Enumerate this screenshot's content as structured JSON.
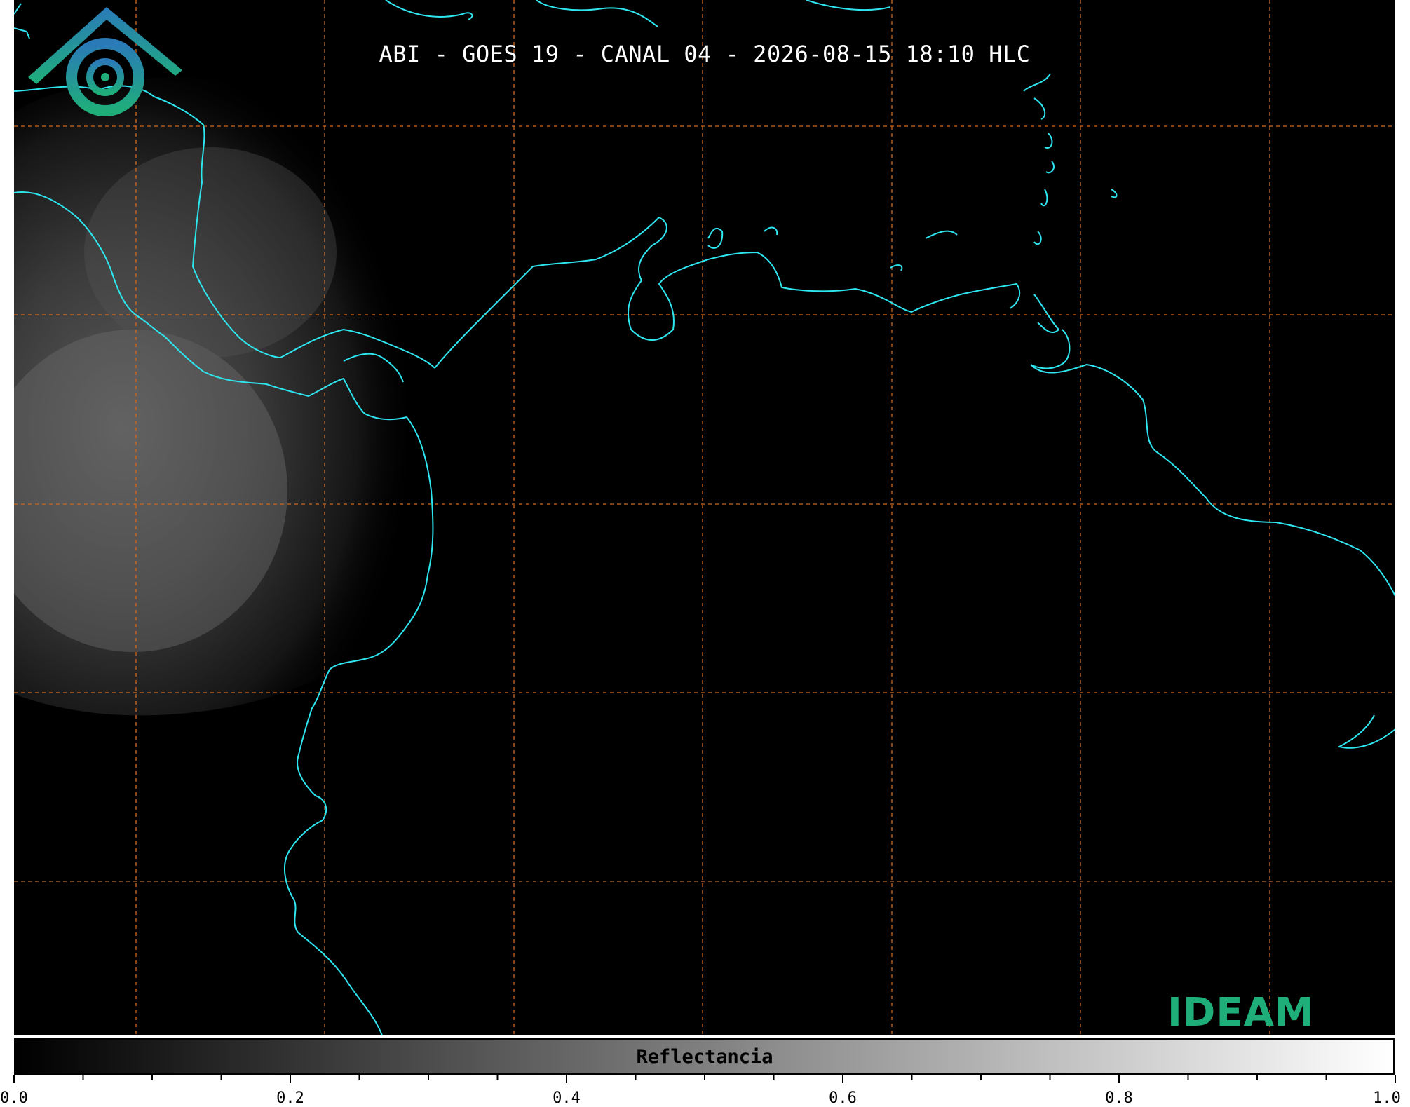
{
  "title": "ABI - GOES 19 - CANAL 04 - 2026-08-15 18:10 HLC",
  "logo": {
    "text": "IDEAM",
    "icon": "ideam-logo-icon"
  },
  "colorbar": {
    "label": "Reflectancia",
    "range": [
      0.0,
      1.0
    ],
    "tick_labels": [
      "0.0",
      "0.2",
      "0.4",
      "0.6",
      "0.8",
      "1.0"
    ],
    "colors": {
      "low": "#000000",
      "high": "#ffffff"
    }
  },
  "map": {
    "coastline_color": "#2ee6f0",
    "gridline_color": "#d2691e",
    "gridlines": "dashed"
  }
}
